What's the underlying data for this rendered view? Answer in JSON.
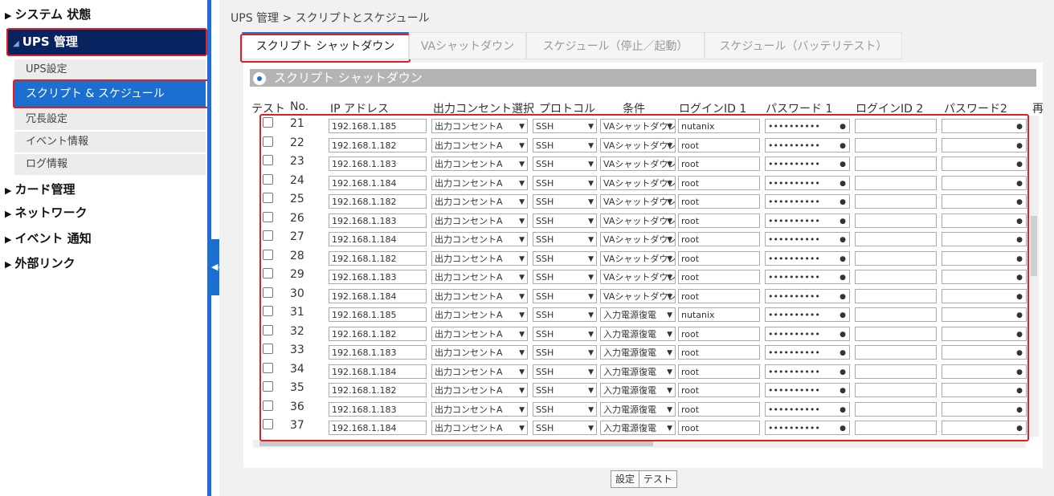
{
  "sidebar": {
    "system_status": "システム 状態",
    "ups_mgmt": "UPS 管理",
    "sub_items": [
      "UPS設定",
      "スクリプト & スケジュール",
      "冗長設定",
      "イベント情報",
      "ログ情報"
    ],
    "card_mgmt": "カード管理",
    "network": "ネットワーク",
    "event_notify": "イベント 通知",
    "external_link": "外部リンク"
  },
  "breadcrumb": "UPS 管理 > スクリプトとスケジュール",
  "tabs": [
    "スクリプト シャットダウン",
    "VAシャットダウン",
    "スケジュール（停止／起動）",
    "スケジュール（バッテリテスト）"
  ],
  "section_title": "スクリプト シャットダウン",
  "columns": [
    "テスト",
    "No.",
    "IP アドレス",
    "出力コンセント選択",
    "プロトコル",
    "条件",
    "ログインID 1",
    "パスワード 1",
    "ログインID 2",
    "パスワード2",
    "再"
  ],
  "rows": [
    {
      "no": "21",
      "ip": "192.168.1.185",
      "outlet": "出力コンセントA",
      "protocol": "SSH",
      "condition": "VAシャットダウン",
      "login1": "nutanix",
      "password1": "••••••••••"
    },
    {
      "no": "22",
      "ip": "192.168.1.182",
      "outlet": "出力コンセントA",
      "protocol": "SSH",
      "condition": "VAシャットダウン",
      "login1": "root",
      "password1": "••••••••••"
    },
    {
      "no": "23",
      "ip": "192.168.1.183",
      "outlet": "出力コンセントA",
      "protocol": "SSH",
      "condition": "VAシャットダウン",
      "login1": "root",
      "password1": "••••••••••"
    },
    {
      "no": "24",
      "ip": "192.168.1.184",
      "outlet": "出力コンセントA",
      "protocol": "SSH",
      "condition": "VAシャットダウン",
      "login1": "root",
      "password1": "••••••••••"
    },
    {
      "no": "25",
      "ip": "192.168.1.182",
      "outlet": "出力コンセントA",
      "protocol": "SSH",
      "condition": "VAシャットダウン",
      "login1": "root",
      "password1": "••••••••••"
    },
    {
      "no": "26",
      "ip": "192.168.1.183",
      "outlet": "出力コンセントA",
      "protocol": "SSH",
      "condition": "VAシャットダウン",
      "login1": "root",
      "password1": "••••••••••"
    },
    {
      "no": "27",
      "ip": "192.168.1.184",
      "outlet": "出力コンセントA",
      "protocol": "SSH",
      "condition": "VAシャットダウン",
      "login1": "root",
      "password1": "••••••••••"
    },
    {
      "no": "28",
      "ip": "192.168.1.182",
      "outlet": "出力コンセントA",
      "protocol": "SSH",
      "condition": "VAシャットダウン",
      "login1": "root",
      "password1": "••••••••••"
    },
    {
      "no": "29",
      "ip": "192.168.1.183",
      "outlet": "出力コンセントA",
      "protocol": "SSH",
      "condition": "VAシャットダウン",
      "login1": "root",
      "password1": "••••••••••"
    },
    {
      "no": "30",
      "ip": "192.168.1.184",
      "outlet": "出力コンセントA",
      "protocol": "SSH",
      "condition": "VAシャットダウン",
      "login1": "root",
      "password1": "••••••••••"
    },
    {
      "no": "31",
      "ip": "192.168.1.185",
      "outlet": "出力コンセントA",
      "protocol": "SSH",
      "condition": "入力電源復電",
      "login1": "nutanix",
      "password1": "••••••••••"
    },
    {
      "no": "32",
      "ip": "192.168.1.182",
      "outlet": "出力コンセントA",
      "protocol": "SSH",
      "condition": "入力電源復電",
      "login1": "root",
      "password1": "••••••••••"
    },
    {
      "no": "33",
      "ip": "192.168.1.183",
      "outlet": "出力コンセントA",
      "protocol": "SSH",
      "condition": "入力電源復電",
      "login1": "root",
      "password1": "••••••••••"
    },
    {
      "no": "34",
      "ip": "192.168.1.184",
      "outlet": "出力コンセントA",
      "protocol": "SSH",
      "condition": "入力電源復電",
      "login1": "root",
      "password1": "••••••••••"
    },
    {
      "no": "35",
      "ip": "192.168.1.182",
      "outlet": "出力コンセントA",
      "protocol": "SSH",
      "condition": "入力電源復電",
      "login1": "root",
      "password1": "••••••••••"
    },
    {
      "no": "36",
      "ip": "192.168.1.183",
      "outlet": "出力コンセントA",
      "protocol": "SSH",
      "condition": "入力電源復電",
      "login1": "root",
      "password1": "••••••••••"
    },
    {
      "no": "37",
      "ip": "192.168.1.184",
      "outlet": "出力コンセントA",
      "protocol": "SSH",
      "condition": "入力電源復電",
      "login1": "root",
      "password1": "••••••••••"
    }
  ],
  "buttons": {
    "save": "設定",
    "test": "テスト"
  },
  "colors": {
    "accent": "#1c6ed1",
    "nav_active": "#08235f",
    "highlight_box": "#e02020"
  }
}
